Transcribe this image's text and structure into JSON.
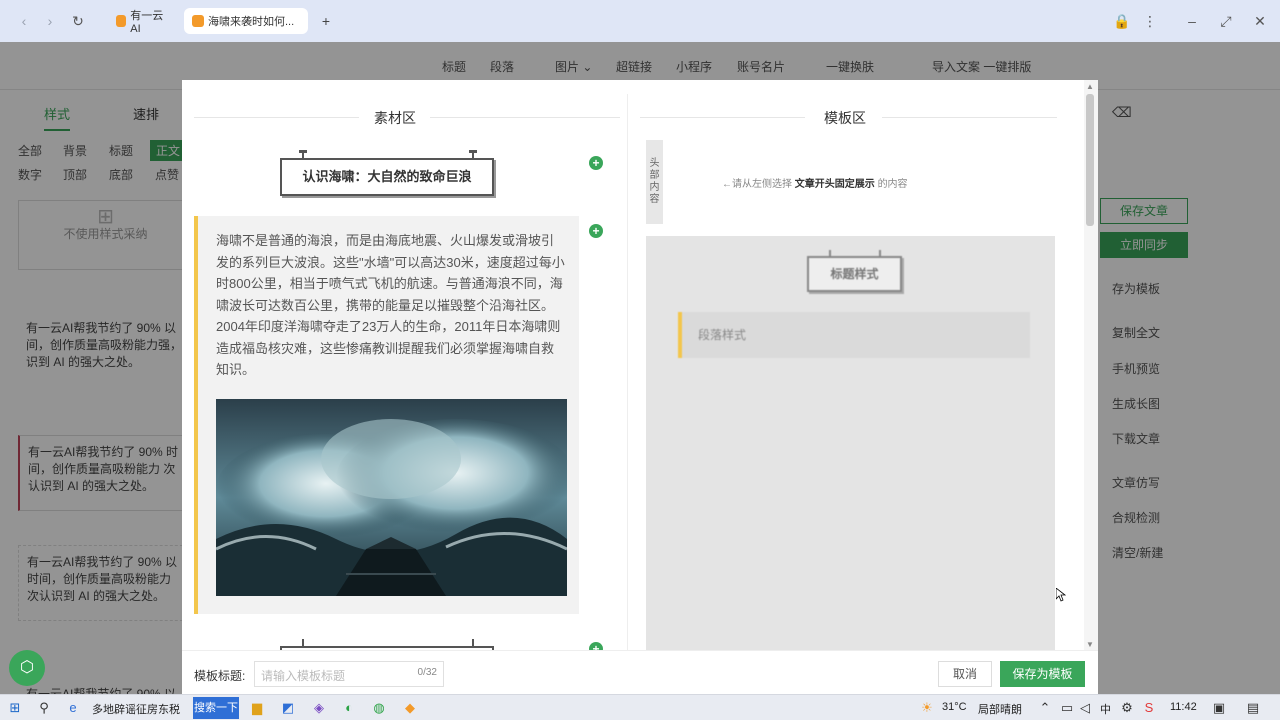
{
  "browser": {
    "tabs": [
      {
        "label": "有一云 AI"
      },
      {
        "label": "海啸来袭时如何..."
      }
    ],
    "new_tab": "+"
  },
  "editor_toolbar": [
    "标题",
    "段落",
    "图片 ⌄",
    "超链接",
    "小程序",
    "账号名片",
    "一键换肤",
    "导入文案 一键排版"
  ],
  "left_panel": {
    "tabs": [
      "样式",
      "速排"
    ],
    "chips_row1": [
      "全部",
      "背景",
      "标题",
      "正文"
    ],
    "chips_row2": [
      "数字",
      "顶部",
      "底部",
      "点赞"
    ],
    "no_style": "不使用样式采纳",
    "cards": [
      "有一云AI帮我节约了 90% 以 间，创作质量高吸粉能力强， 识到 AI 的强大之处。",
      "有一云AI帮我节约了 90% 时间，创作质量高吸粉能力 次认识到 AI 的强大之处。",
      "有一云AI帮我节约了 90% 以 时间，创作质量高吸粉能力 次认识到 AI 的强大之处。",
      "有一云AI帮我节约了 90% 以"
    ]
  },
  "right_panel": {
    "save_article": "保存文章",
    "sync_now": "立即同步",
    "items": [
      "存为模板",
      "复制全文",
      "手机预览",
      "生成长图",
      "下载文章",
      "文章仿写",
      "合规检测",
      "清空/新建"
    ]
  },
  "modal": {
    "material_title": "素材区",
    "template_title": "模板区",
    "heading": "认识海啸：大自然的致命巨浪",
    "paragraph": "海啸不是普通的海浪，而是由海底地震、火山爆发或滑坡引发的系列巨大波浪。这些\"水墙\"可以高达30米，速度超过每小时800公里，相当于喷气式飞机的航速。与普通海浪不同，海啸波长可达数百公里，携带的能量足以摧毁整个沿海社区。2004年印度洋海啸夺走了23万人的生命，2011年日本海啸则造成福岛核灾难，这些惨痛教训提醒我们必须掌握海啸自救知识。",
    "head_tag": "头部内容",
    "head_hint_prefix": "←请从左侧选择",
    "head_hint_bold": "文章开头固定展示",
    "head_hint_suffix": "的内容",
    "tpl_title_style": "标题样式",
    "tpl_para_style": "段落样式",
    "footer_label": "模板标题:",
    "footer_placeholder": "请输入模板标题",
    "footer_count": "0/32",
    "cancel": "取消",
    "save_template": "保存为模板"
  },
  "taskbar": {
    "news": "多地辟谣征房东税",
    "search": "搜索一下",
    "weather_temp": "31°C",
    "weather_desc": "局部晴朗",
    "ime": "中",
    "time": "11:42"
  },
  "colors": {
    "accent": "#3aa65a",
    "quote_bar": "#f3c64c"
  }
}
